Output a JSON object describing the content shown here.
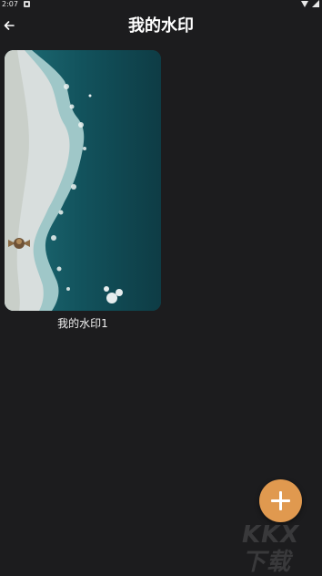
{
  "status_bar": {
    "time": "2:07",
    "icons": [
      "notification-icon",
      "wifi-icon",
      "battery-icon"
    ]
  },
  "app_bar": {
    "back_icon": "arrow-left-icon",
    "title": "我的水印"
  },
  "watermarks": [
    {
      "label": "我的水印1",
      "thumbnail": "aerial-ocean-shoreline"
    }
  ],
  "fab": {
    "icon": "plus-icon",
    "color": "#e0994f"
  },
  "site_watermark": {
    "text": "KKX下载"
  },
  "colors": {
    "background": "#1c1c1e",
    "accent": "#e0994f"
  }
}
